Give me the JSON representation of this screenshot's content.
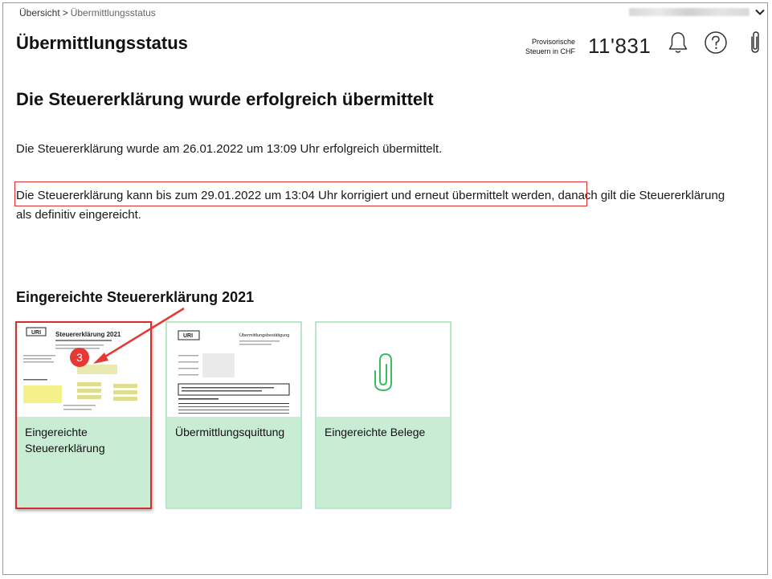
{
  "breadcrumb": {
    "root": "Übersicht",
    "separator": ">",
    "current": "Übermittlungsstatus"
  },
  "header": {
    "title": "Übermittlungsstatus",
    "tax_label_line1": "Provisorische",
    "tax_label_line2": "Steuern in CHF",
    "tax_amount": "11'831"
  },
  "icons": {
    "notifications": "bell-icon",
    "help": "help-circle-icon",
    "attachments": "paperclip-icon",
    "user_menu": "chevron-down-icon"
  },
  "main": {
    "headline": "Die Steuererklärung wurde erfolgreich übermittelt",
    "paragraph1": "Die Steuererklärung wurde am 26.01.2022 um 13:09 Uhr erfolgreich übermittelt.",
    "paragraph2_highlight": "Die Steuererklärung kann bis zum 29.01.2022 um 13:04 Uhr korrigiert und erneut übermittelt werden,",
    "paragraph2_rest": " danach gilt die Steuererklärung als definitiv eingereicht."
  },
  "section": {
    "title": "Eingereichte Steuererklärung 2021",
    "cards": [
      {
        "label": "Eingereichte Steuererklärung",
        "thumb_title": "Steuererklärung 2021",
        "thumb_logo": "URI"
      },
      {
        "label": "Übermittlungsquittung",
        "thumb_title": "Übermittlungsbestätigung",
        "thumb_logo": "URI"
      },
      {
        "label": "Eingereichte Belege"
      }
    ]
  },
  "annotation": {
    "step_number": "3"
  },
  "colors": {
    "card_bg": "#c9ecd5",
    "card_border": "#b8e6c8",
    "accent_green": "#3dbb5f",
    "highlight_red": "#e03131"
  }
}
